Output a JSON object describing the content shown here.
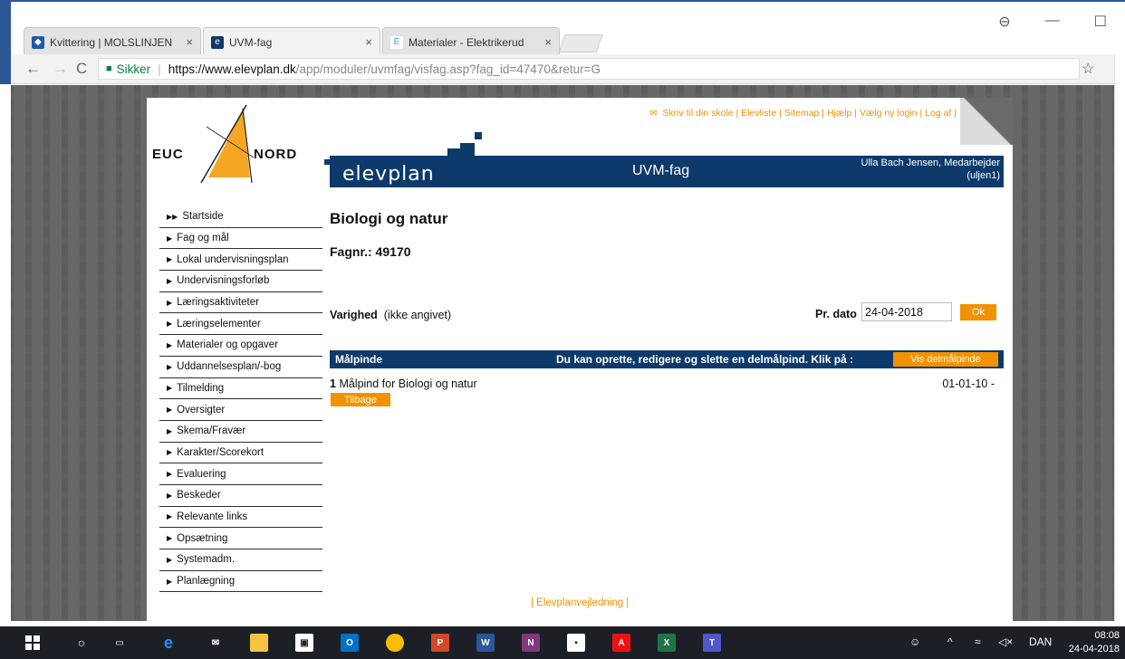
{
  "browser": {
    "tabs": [
      {
        "title": "Kvittering | MOLSLINJEN",
        "close": "×"
      },
      {
        "title": "UVM-fag",
        "close": "×"
      },
      {
        "title": "Materialer - Elektrikerud",
        "close": "×"
      }
    ],
    "window_buttons": [
      "⊖",
      "—",
      "☐"
    ],
    "url_secure_label": "Sikker",
    "url_host": "https://www.elevplan.dk",
    "url_path": "/app/moduler/uvmfag/visfag.asp?fag_id=47470&retur=G"
  },
  "header": {
    "top_links": [
      "Skriv til din skole",
      "Elevliste",
      "Sitemap",
      "Hjælp",
      "Vælg ny login",
      "Log af"
    ],
    "logo_left": "EUC",
    "logo_right": "NORD",
    "brand": "elevplan",
    "module_title": "UVM-fag",
    "user_name": "Ulla Bach Jensen, Medarbejder",
    "user_login": "(uljen1)"
  },
  "menu": {
    "items": [
      "Startside",
      "Fag og mål",
      "Lokal undervisningsplan",
      "Undervisningsforløb",
      "Læringsaktiviteter",
      "Læringselementer",
      "Materialer og opgaver",
      "Uddannelsesplan/-bog",
      "Tilmelding",
      "Oversigter",
      "Skema/Fravær",
      "Karakter/Scorekort",
      "Evaluering",
      "Beskeder",
      "Relevante links",
      "Opsætning",
      "Systemadm.",
      "Planlægning"
    ]
  },
  "main": {
    "title": "Biologi og natur",
    "fagnr": "Fagnr.: 49170",
    "varighed_label": "Varighed",
    "varighed_value": "(ikke angivet)",
    "pr_dato_label": "Pr. dato",
    "pr_dato_value": "24-04-2018",
    "ok_label": "Ok",
    "malpinde_label": "Målpinde",
    "malpinde_hint": "Du kan oprette, redigere og slette en delmålpind. Klik på :",
    "vis_label": "Vis delmålpinde",
    "row_number": "1",
    "row_text": "Målpind for Biologi og natur",
    "row_date": "01-01-10 -",
    "tilbage_label": "Tilbage"
  },
  "footer": {
    "link": "| Elevplanvejledning |"
  },
  "taskbar": {
    "lang": "DAN",
    "time": "08:08",
    "date": "24-04-2018"
  }
}
